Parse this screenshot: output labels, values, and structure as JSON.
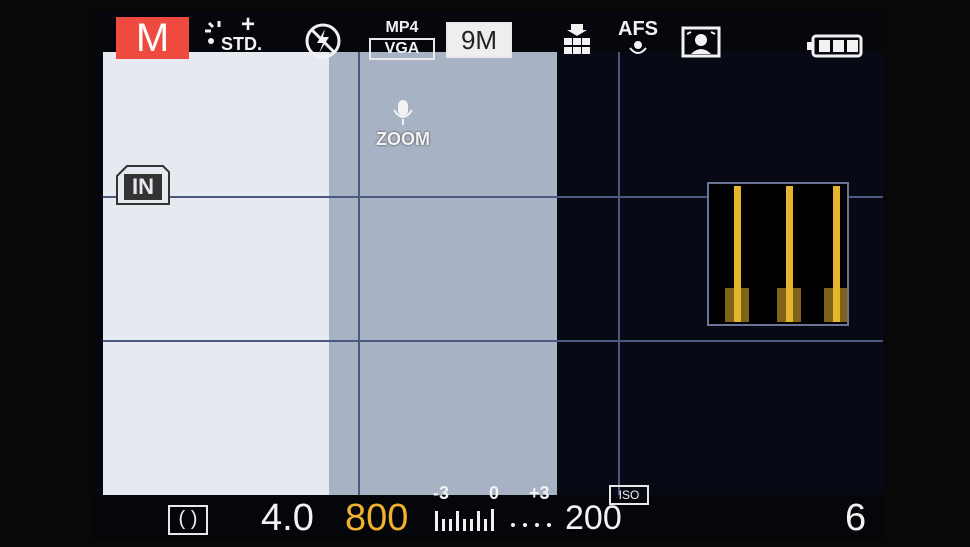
{
  "mode": {
    "label": "M"
  },
  "top_status": {
    "film_style": "STD.",
    "film_style_adjust": "+",
    "movie_format": "MP4",
    "movie_quality": "VGA",
    "picture_size": "9M",
    "focus_mode": "AFS",
    "icons": [
      "film-mode-icon",
      "flash-off-icon",
      "quality-icon",
      "macro-icon",
      "face-detect-icon",
      "battery-icon"
    ]
  },
  "microphone": {
    "label": "ZOOM"
  },
  "storage": {
    "label": "IN"
  },
  "histogram": {
    "color": "#e5b52e",
    "peaks": [
      0.2,
      0.58,
      0.92
    ]
  },
  "bottom_status": {
    "metering_icon": "( )",
    "aperture": "4.0",
    "shutter": "800",
    "exposure_scale": {
      "minus": "-3",
      "zero": "0",
      "plus": "+3"
    },
    "iso_label": "ISO",
    "iso_value": "200",
    "shots_remaining": "6"
  },
  "colors": {
    "mode_bg": "#ee4a3f",
    "shutter_text": "#f0b12e",
    "osd_text": "#f2f2f2",
    "panel_white": "#e6e9ef",
    "panel_blue": "#a8b2c5",
    "panel_dark": "#070a14"
  }
}
